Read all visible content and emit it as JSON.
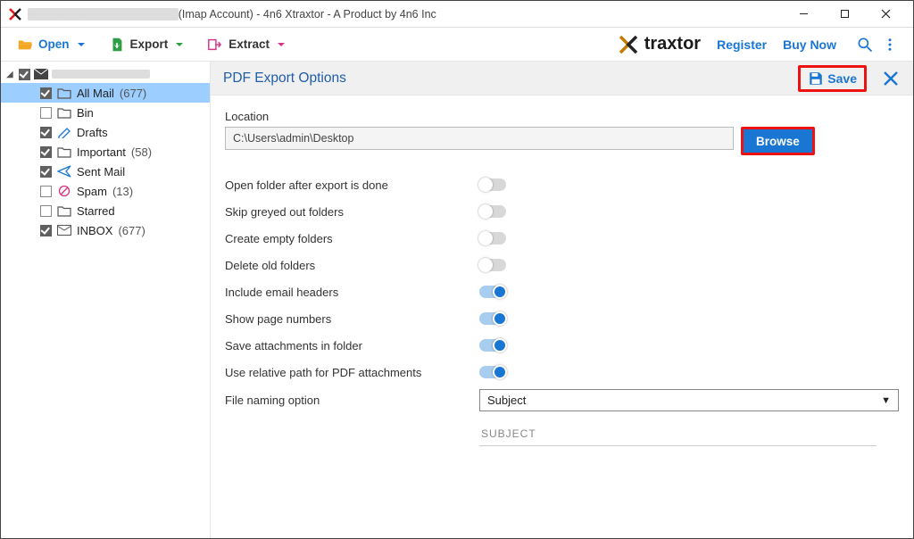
{
  "window": {
    "title_suffix": "(Imap Account) - 4n6 Xtraxtor - A Product by 4n6 Inc"
  },
  "toolbar": {
    "open": "Open",
    "export": "Export",
    "extract": "Extract",
    "brand": "traxtor",
    "register": "Register",
    "buy": "Buy Now"
  },
  "sidebar": {
    "items": [
      {
        "label": "All Mail",
        "count": "(677)",
        "checked": true,
        "selected": true,
        "icon": "folder"
      },
      {
        "label": "Bin",
        "count": "",
        "checked": false,
        "selected": false,
        "icon": "folder"
      },
      {
        "label": "Drafts",
        "count": "",
        "checked": true,
        "selected": false,
        "icon": "drafts"
      },
      {
        "label": "Important",
        "count": "(58)",
        "checked": true,
        "selected": false,
        "icon": "folder"
      },
      {
        "label": "Sent Mail",
        "count": "",
        "checked": true,
        "selected": false,
        "icon": "sent"
      },
      {
        "label": "Spam",
        "count": "(13)",
        "checked": false,
        "selected": false,
        "icon": "spam"
      },
      {
        "label": "Starred",
        "count": "",
        "checked": false,
        "selected": false,
        "icon": "folder"
      },
      {
        "label": "INBOX",
        "count": "(677)",
        "checked": true,
        "selected": false,
        "icon": "inbox"
      }
    ]
  },
  "panel": {
    "title": "PDF Export Options",
    "save": "Save",
    "location_label": "Location",
    "location_value": "C:\\Users\\admin\\Desktop",
    "browse": "Browse",
    "naming_label": "File naming option",
    "naming_value": "Subject",
    "naming_preview": "SUBJECT",
    "options": [
      {
        "label": "Open folder after export is done",
        "on": false
      },
      {
        "label": "Skip greyed out folders",
        "on": false
      },
      {
        "label": "Create empty folders",
        "on": false
      },
      {
        "label": "Delete old folders",
        "on": false
      },
      {
        "label": "Include email headers",
        "on": true
      },
      {
        "label": "Show page numbers",
        "on": true
      },
      {
        "label": "Save attachments in folder",
        "on": true
      },
      {
        "label": "Use relative path for PDF attachments",
        "on": true
      }
    ]
  }
}
